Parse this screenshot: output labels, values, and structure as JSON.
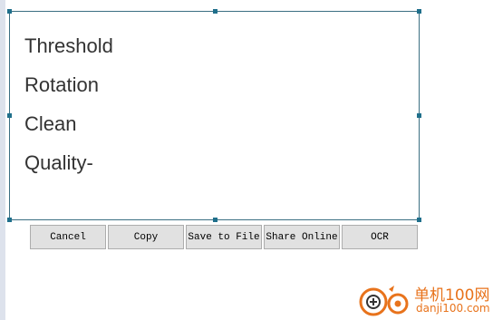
{
  "capture": {
    "lines": [
      "Threshold",
      "Rotation",
      "Clean",
      "Quality-"
    ]
  },
  "toolbar": {
    "buttons": [
      {
        "label": "Cancel"
      },
      {
        "label": "Copy"
      },
      {
        "label": "Save to File"
      },
      {
        "label": "Share Online"
      },
      {
        "label": "OCR"
      }
    ]
  },
  "watermark": {
    "cn_text": "单机100网",
    "url": "danji100.com",
    "color": "#e8731c"
  },
  "colors": {
    "frame_border": "#3b6f82",
    "handle": "#1f6f8b",
    "button_bg": "#e1e1e1"
  }
}
